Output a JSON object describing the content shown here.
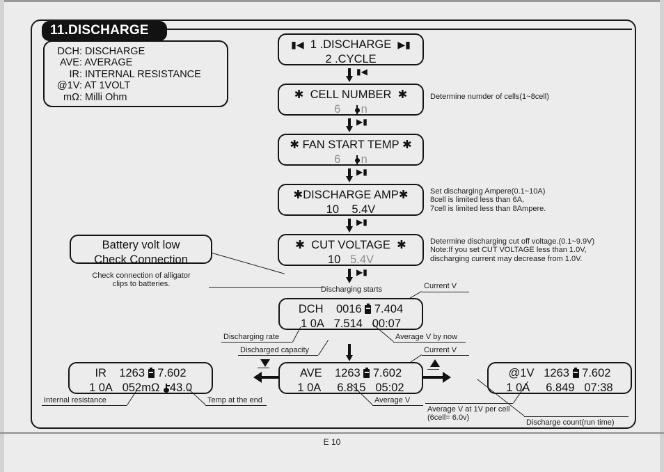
{
  "section": {
    "title": "11.DISCHARGE"
  },
  "legend": {
    "rows": [
      {
        "label": "DCH:",
        "text": "DISCHARGE"
      },
      {
        "label": "AVE:",
        "text": "AVERAGE"
      },
      {
        "label": "IR:",
        "text": "INTERNAL RESISTANCE"
      },
      {
        "label": "@1V:",
        "text": "AT 1VOLT"
      },
      {
        "label": "mΩ:",
        "text": "Milli Ohm"
      }
    ]
  },
  "screens": {
    "menu": {
      "line1": "1 .DISCHARGE",
      "line2": "2 .CYCLE",
      "left_icon": "prev-track-icon",
      "right_icon": "next-track-icon"
    },
    "cell_number": {
      "title": "CELL NUMBER",
      "value": "6",
      "unit": "n",
      "star": "✱"
    },
    "fan_start_temp": {
      "title": "FAN START TEMP",
      "value": "6",
      "unit": "n",
      "star": "✱"
    },
    "discharge_amp": {
      "title": "DISCHARGE AMP",
      "value": "10",
      "volt": "5.4V",
      "star": "✱"
    },
    "cut_voltage": {
      "title": "CUT VOLTAGE",
      "value": "10",
      "volt": "5.4V",
      "star": "✱"
    },
    "error": {
      "line1": "Battery volt low",
      "line2": "Check Connection"
    },
    "dch": {
      "mode": "DCH",
      "capacity": "0016",
      "current_v": "7.404",
      "rate": "1 0A",
      "average_v": "7.514",
      "time": "00:07"
    },
    "ave": {
      "mode": "AVE",
      "capacity": "1263",
      "current_v": "7.602",
      "rate": "1 0A",
      "average_v": "6.815",
      "time": "05:02"
    },
    "ir": {
      "mode": "IR",
      "capacity": "1263",
      "current_v": "7.602",
      "rate": "1 0A",
      "resistance": "052mΩ",
      "temp": "43.0"
    },
    "at1v": {
      "mode": "@1V",
      "capacity": "1263",
      "current_v": "7.602",
      "rate": "1 0A",
      "average_v": "6.849",
      "time": "07:38"
    }
  },
  "notes": {
    "cell_number": "Determine numder of cells(1~8cell)",
    "discharge_amp": "Set discharging Ampere(0.1~10A)\n8cell is limited less than 6A,\n7cell is limited less than 8Ampere.",
    "cut_voltage": "Determine discharging cut off voltage.(0.1~9.9V)\nNote:If you set CUT VOLTAGE less than 1.0V,\ndischarging current may decrease from 1.0V.",
    "error_hint": "Check connection of alligator\nclips to batteries.",
    "discharging_starts": "Discharging starts",
    "current_v_top": "Current V",
    "discharging_rate": "Discharging rate",
    "average_v_by_now": "Average V by now",
    "discharged_capacity": "Discharged capacity",
    "current_v_mid": "Current V",
    "average_v": "Average V",
    "internal_resistance": "Internal resistance",
    "temp_at_end": "Temp at the end",
    "average_at_1v": "Average V at 1V per cell\n(6cell= 6.0v)",
    "discharge_count": "Discharge count(run time)"
  },
  "page": {
    "footer": "E 10"
  }
}
